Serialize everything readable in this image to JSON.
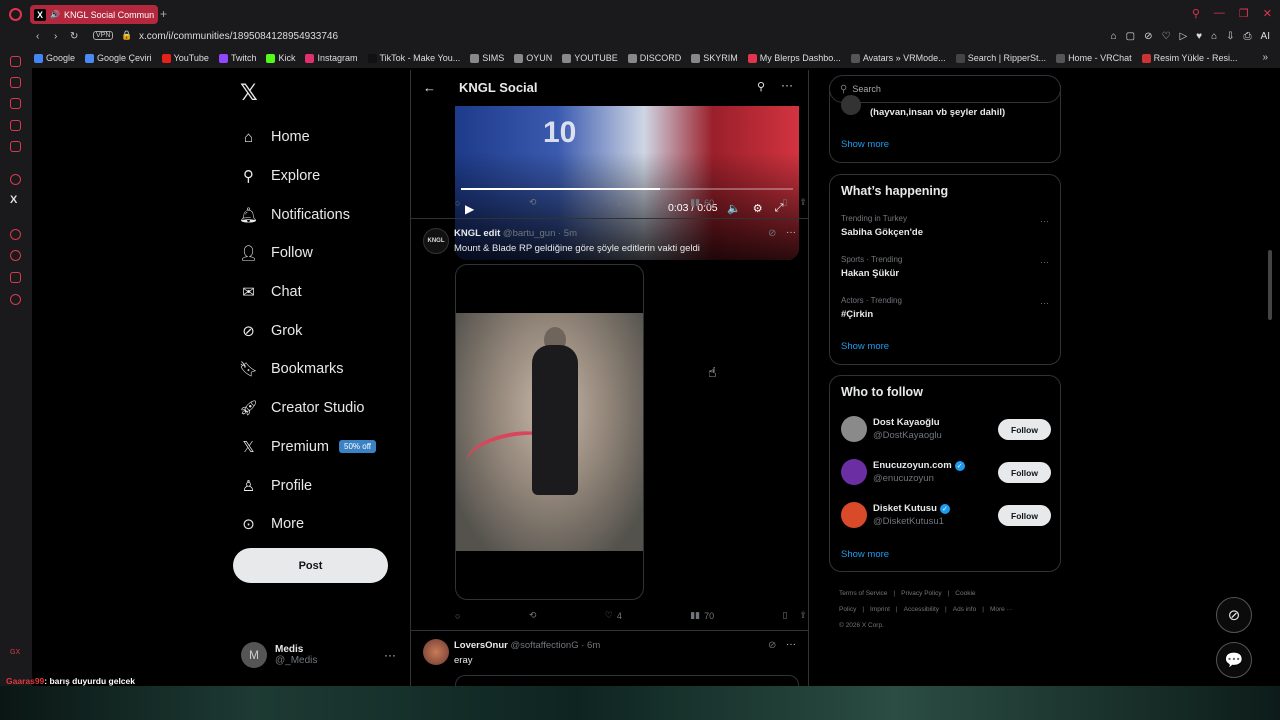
{
  "browser": {
    "tab_title": "KNGL Social Commun",
    "url": "x.com/i/communities/1895084128954933746",
    "vpn_label": "VPN",
    "addr_icons": [
      "⌂",
      "▢",
      "⊘",
      "♡",
      "▷",
      "♥",
      "⌂",
      "⇩",
      "⎙",
      "AI"
    ],
    "bookmarks": [
      "Google",
      "Google Çeviri",
      "YouTube",
      "Twitch",
      "Kick",
      "Instagram",
      "TikTok - Make You...",
      "SIMS",
      "OYUN",
      "YOUTUBE",
      "DISCORD",
      "SKYRIM",
      "My Blerps Dashbo...",
      "Avatars » VRMode...",
      "Search | RipperSt...",
      "Home - VRChat",
      "Resim Yükle - Resi..."
    ]
  },
  "nav": {
    "items": [
      {
        "label": "Home",
        "icon": "home-icon"
      },
      {
        "label": "Explore",
        "icon": "search-icon"
      },
      {
        "label": "Notifications",
        "icon": "bell-icon"
      },
      {
        "label": "Follow",
        "icon": "person-add-icon"
      },
      {
        "label": "Chat",
        "icon": "mail-icon"
      },
      {
        "label": "Grok",
        "icon": "grok-icon"
      },
      {
        "label": "Bookmarks",
        "icon": "bookmark-icon"
      },
      {
        "label": "Creator Studio",
        "icon": "rocket-icon"
      },
      {
        "label": "Premium",
        "icon": "x-icon",
        "badge": "50% off"
      },
      {
        "label": "Profile",
        "icon": "person-icon"
      },
      {
        "label": "More",
        "icon": "more-circle-icon"
      }
    ],
    "post_label": "Post"
  },
  "account": {
    "initial": "M",
    "name": "Medis",
    "handle": "@_Medis"
  },
  "header": {
    "title": "KNGL Social"
  },
  "video1": {
    "time": "0:03 / 0:05",
    "jersey": "10",
    "progress": 0.6
  },
  "tweet1_actions": {
    "likes": "1",
    "views": "60"
  },
  "tweet2": {
    "name": "KNGL edit",
    "handle": "@bartu_gun",
    "time": "· 5m",
    "text": "Mount & Blade RP geldiğine göre şöyle editlerin vakti geldi",
    "avatar_text": "KNGL",
    "likes": "4",
    "views": "70"
  },
  "tweet3": {
    "name": "LoversOnur",
    "handle": "@softaffectionG",
    "time": "· 6m",
    "text": "eray"
  },
  "search": {
    "placeholder": "Search"
  },
  "prev_card": {
    "text": "(hayvan,insan vb şeyler dahil)",
    "show_more": "Show more"
  },
  "happening": {
    "title": "What’s happening",
    "trends": [
      {
        "context": "Trending in Turkey",
        "name": "Sabiha Gökçen'de"
      },
      {
        "context": "Sports · Trending",
        "name": "Hakan Şükür"
      },
      {
        "context": "Actors · Trending",
        "name": "#Çirkin"
      }
    ],
    "show_more": "Show more"
  },
  "who_to_follow": {
    "title": "Who to follow",
    "users": [
      {
        "name": "Dost Kayaoğlu",
        "handle": "@DostKayaoglu",
        "verified": false,
        "color": "#8a8a8a"
      },
      {
        "name": "Enucuzoyun.com",
        "handle": "@enucuzoyun",
        "verified": true,
        "color": "#6b2fa3"
      },
      {
        "name": "Disket Kutusu",
        "handle": "@DisketKutusu1",
        "verified": true,
        "color": "#d94a2a"
      }
    ],
    "follow_label": "Follow",
    "show_more": "Show more"
  },
  "footer": {
    "links": [
      "Terms of Service",
      "|",
      "Privacy Policy",
      "|",
      "Cookie Policy",
      "|",
      "Imprint",
      "|",
      "Accessibility",
      "|",
      "Ads info",
      "|",
      "More ···"
    ],
    "copyright": "© 2026 X Corp."
  },
  "stream_chat": {
    "user": "Gaaras99",
    "message": ": barış duyurdu gelcek"
  },
  "gx_label": "GX"
}
